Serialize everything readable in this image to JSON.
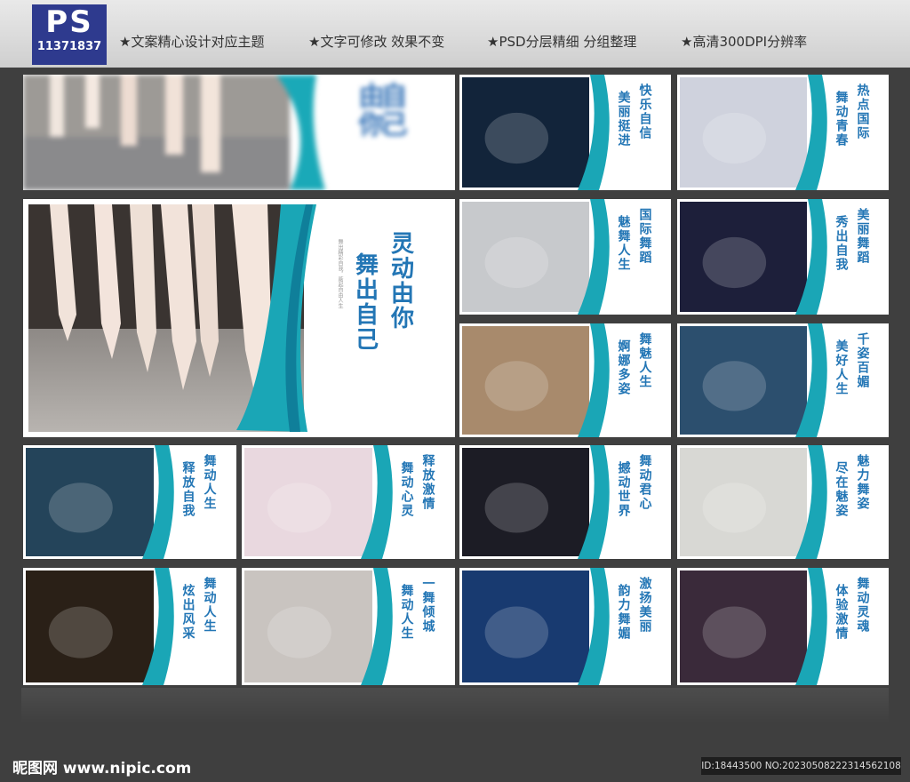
{
  "header": {
    "ps_logo": "PS",
    "ps_number": "11371837",
    "features": [
      "★文案精心设计对应主题",
      "★文字可修改 效果不变",
      "★PSD分层精细 分组整理",
      "★高清300DPI分辨率"
    ]
  },
  "hero": {
    "title_line1": "灵动由你",
    "title_line2": "舞出自己",
    "subtitle": "舞出精彩自我，踮起自由人生"
  },
  "top_blurred": {
    "line1": "由你",
    "line2": "自己"
  },
  "panels": [
    {
      "line1": "快乐自信",
      "line2": "美丽挺进"
    },
    {
      "line1": "热点国际",
      "line2": "舞动青春"
    },
    {
      "line1": "国际舞蹈",
      "line2": "魅舞人生"
    },
    {
      "line1": "美丽舞蹈",
      "line2": "秀出自我"
    },
    {
      "line1": "舞魅人生",
      "line2": "婀娜多姿"
    },
    {
      "line1": "千姿百媚",
      "line2": "美好人生"
    },
    {
      "line1": "舞动人生",
      "line2": "释放自我"
    },
    {
      "line1": "释放激情",
      "line2": "舞动心灵"
    },
    {
      "line1": "舞动君心",
      "line2": "撼动世界"
    },
    {
      "line1": "魅力舞姿",
      "line2": "尽在魅姿"
    },
    {
      "line1": "舞动人生",
      "line2": "炫出风采"
    },
    {
      "line1": "一舞倾城",
      "line2": "舞动人生"
    },
    {
      "line1": "激扬美丽",
      "line2": "韵力舞媚"
    },
    {
      "line1": "舞动灵魂",
      "line2": "体验激情"
    }
  ],
  "footer": {
    "logo": "昵图网 www.nipic.com",
    "id": "ID:18443500 NO:20230508222314562108"
  },
  "colors": {
    "accent": "#2376b5",
    "teal": "#1fa7b8",
    "background": "#3f3f3f"
  }
}
